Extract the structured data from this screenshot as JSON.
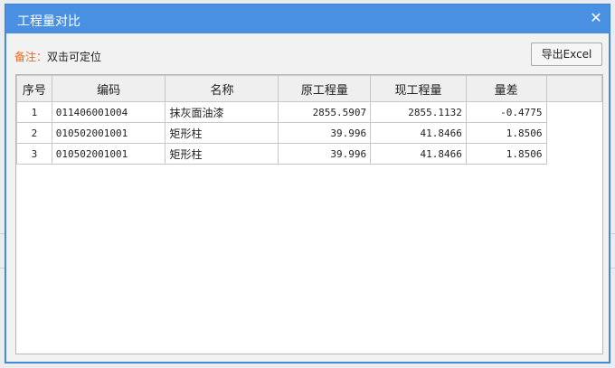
{
  "dialog": {
    "title": "工程量对比",
    "close_icon": "close-icon"
  },
  "note": {
    "label": "备注：",
    "text": "双击可定位"
  },
  "toolbar": {
    "export_label": "导出Excel"
  },
  "table": {
    "columns": [
      "序号",
      "编码",
      "名称",
      "原工程量",
      "现工程量",
      "量差"
    ],
    "rows": [
      {
        "index": "1",
        "code": "011406001004",
        "name": "抹灰面油漆",
        "original": "2855.5907",
        "current": "2855.1132",
        "diff": "-0.4775"
      },
      {
        "index": "2",
        "code": "010502001001",
        "name": "矩形柱",
        "original": "39.996",
        "current": "41.8466",
        "diff": "1.8506"
      },
      {
        "index": "3",
        "code": "010502001001",
        "name": "矩形柱",
        "original": "39.996",
        "current": "41.8466",
        "diff": "1.8506"
      }
    ]
  },
  "colors": {
    "titlebar": "#4a90e2",
    "note_label": "#e8691b"
  }
}
